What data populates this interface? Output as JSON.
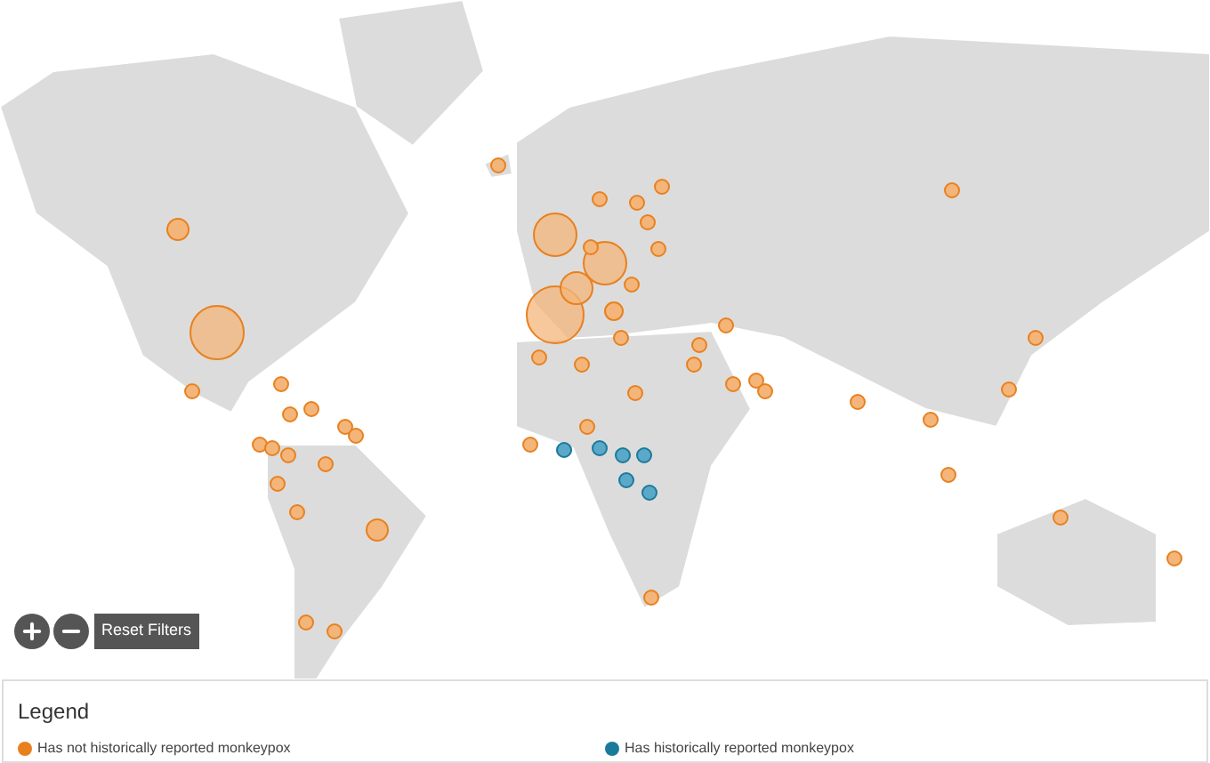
{
  "map": {
    "reset_button": "Reset Filters"
  },
  "legend": {
    "title": "Legend",
    "items": [
      {
        "label": "Has not historically reported monkeypox",
        "color": "#e8801e"
      },
      {
        "label": "Has historically reported monkeypox",
        "color": "#1a7a9a"
      }
    ]
  }
}
